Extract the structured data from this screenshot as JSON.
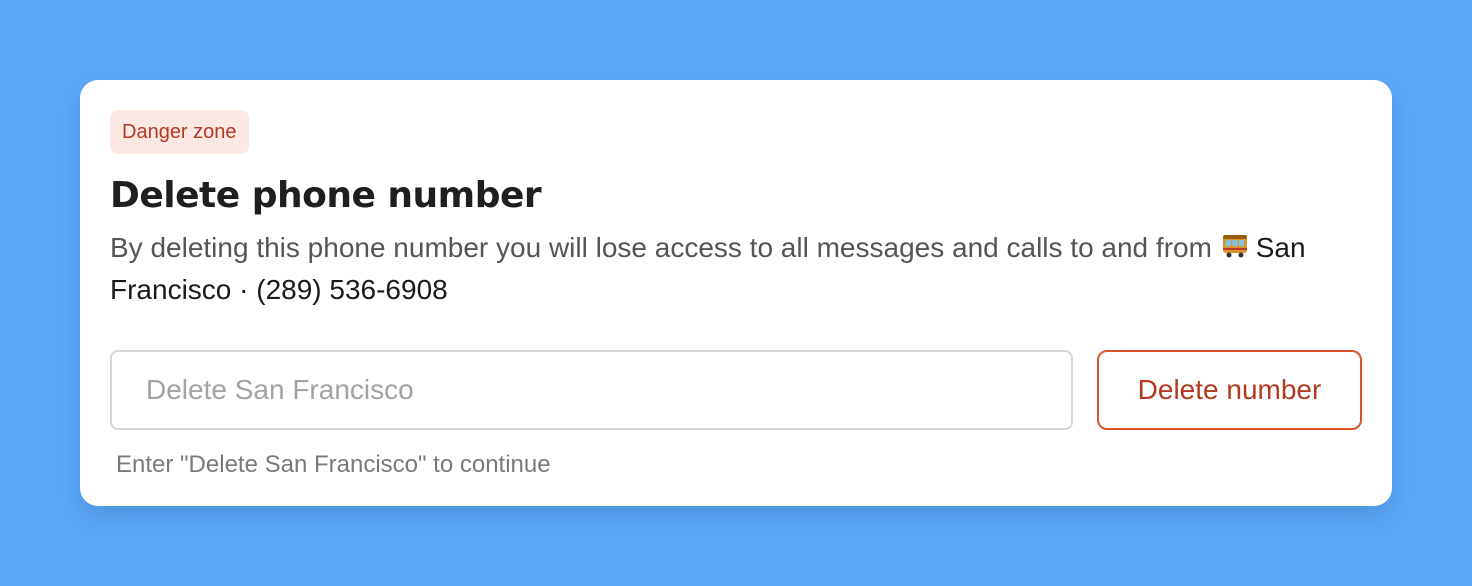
{
  "card": {
    "badge": "Danger zone",
    "title": "Delete phone number",
    "description_prefix": "By deleting this phone number you will lose access to all messages and calls to and from",
    "phone_emoji_icon": "tram-car-icon",
    "phone_label": "San Francisco · (289) 536-6908",
    "input_placeholder": "Delete San Francisco",
    "input_value": "",
    "delete_button_label": "Delete number",
    "hint": "Enter \"Delete San Francisco\" to continue"
  },
  "colors": {
    "background": "#5ba8f7",
    "danger_text": "#b23a22",
    "danger_border": "#d9532e",
    "badge_bg": "#fde8e4"
  }
}
